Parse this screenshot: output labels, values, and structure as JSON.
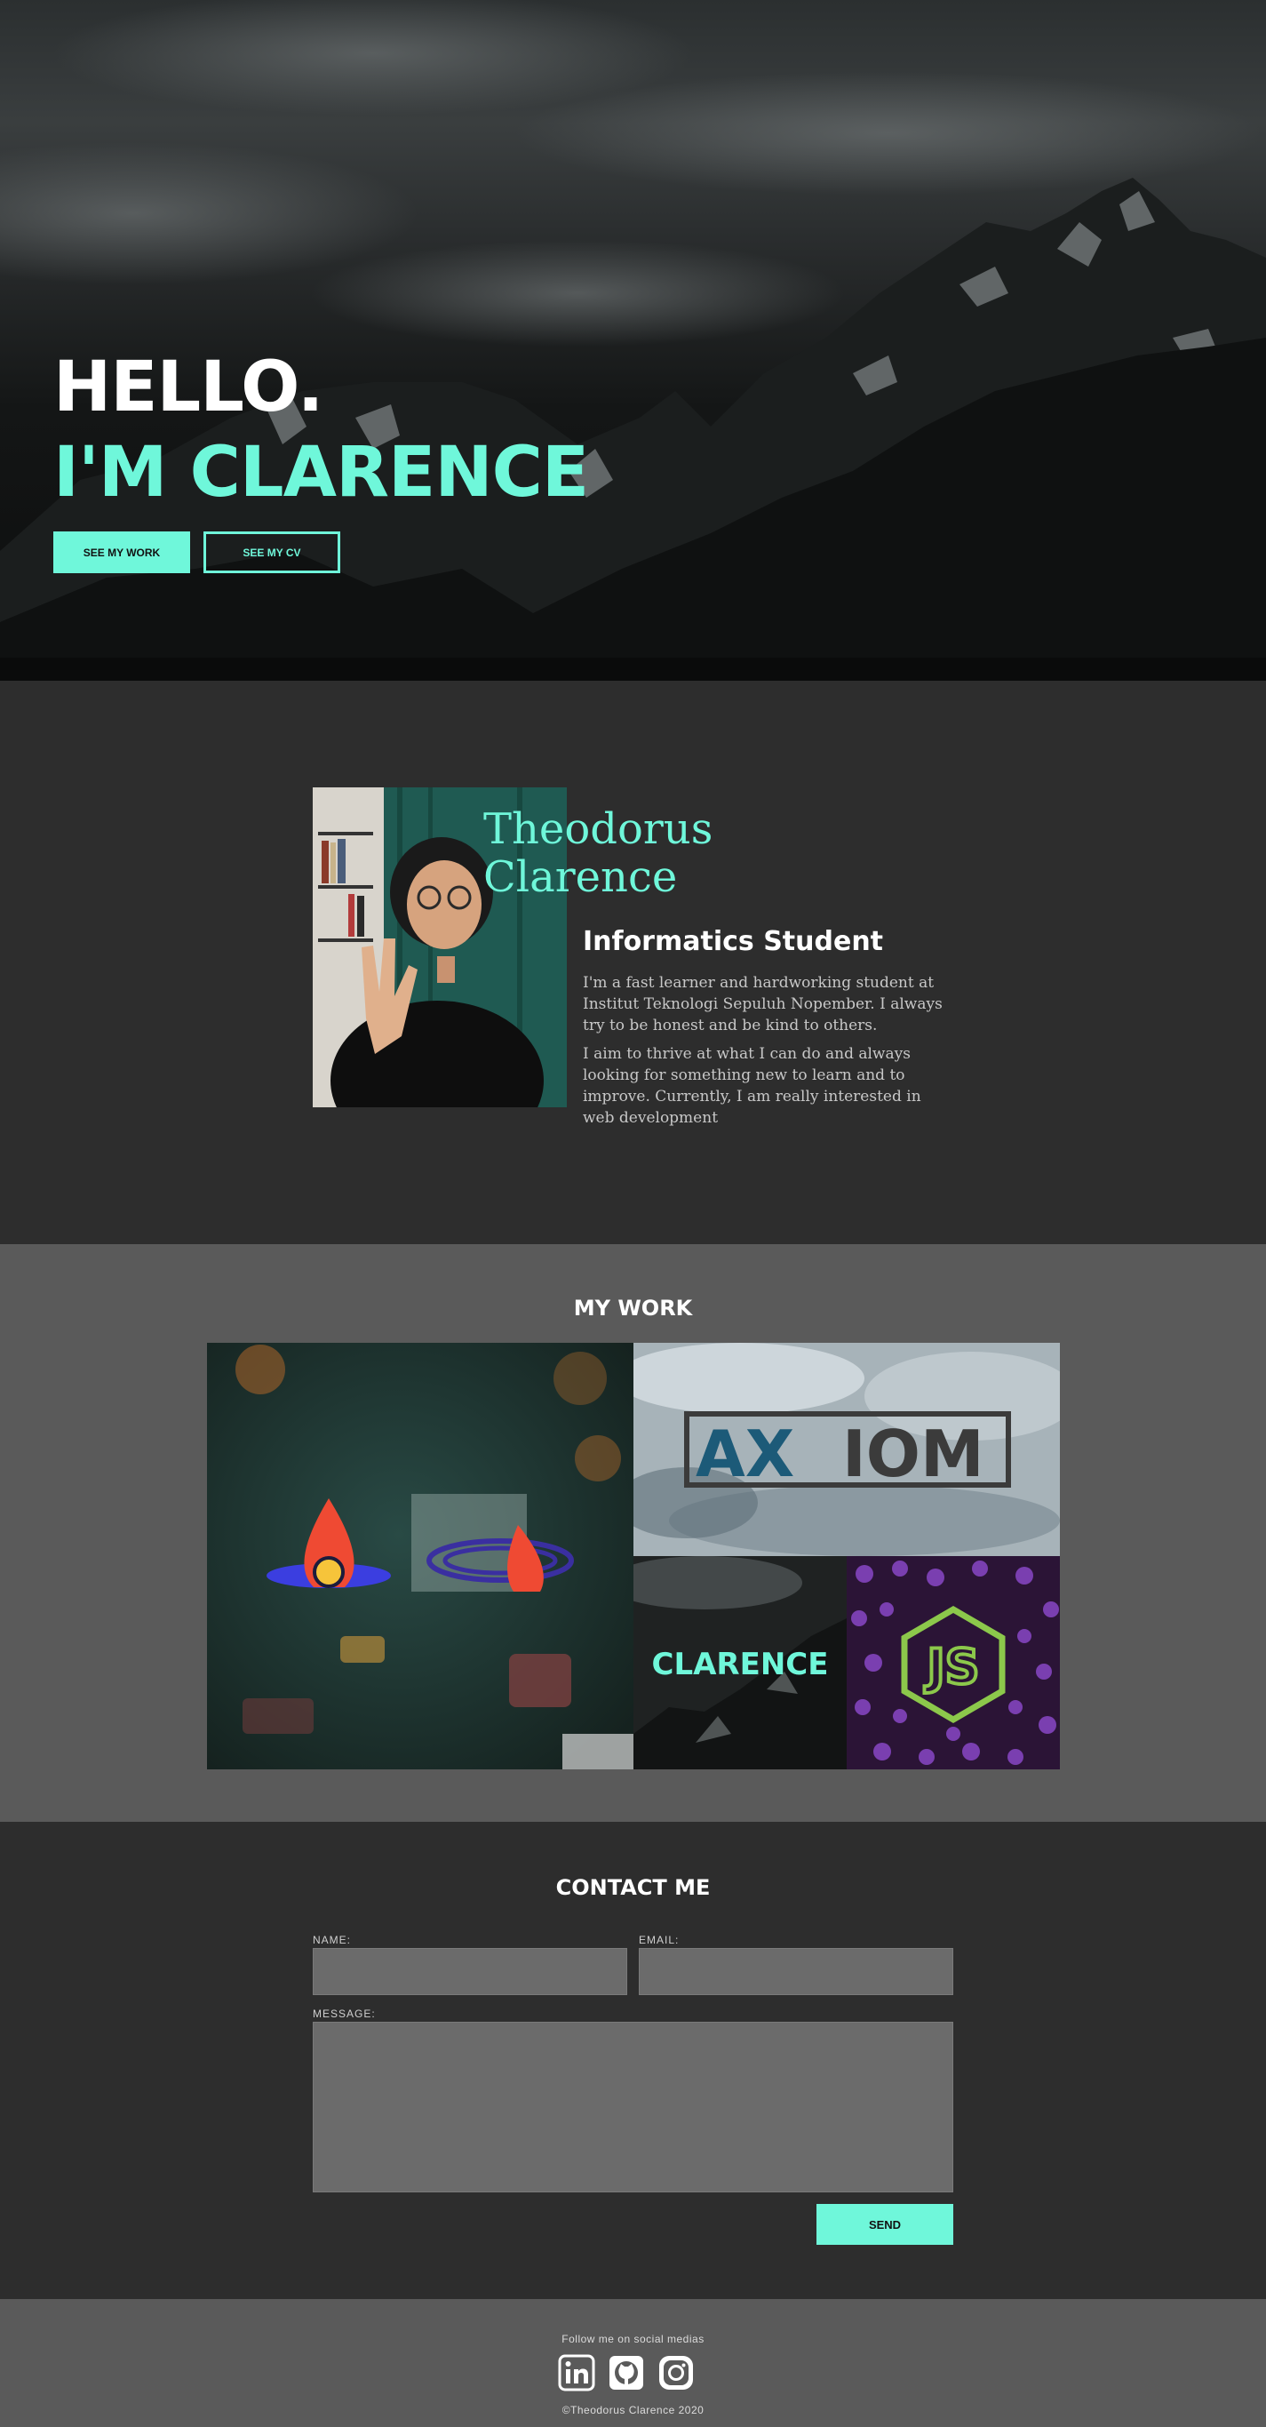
{
  "hero": {
    "line1": "HELLO.",
    "line2": "I'M CLARENCE",
    "btn_work": "SEE MY WORK",
    "btn_cv": "SEE MY CV"
  },
  "about": {
    "name_line1": "Theodorus",
    "name_line2": "Clarence",
    "role": "Informatics Student",
    "bio1": "I'm a fast learner and hardworking student at Institut Teknologi Sepuluh Nopember. I always try to be honest and be kind to others.",
    "bio2": "I aim to thrive at what I can do and always looking for something new to learn and to improve. Currently, I am really interested in web development"
  },
  "work": {
    "title": "MY WORK",
    "tiles": [
      {
        "name": "rocket-planet-project"
      },
      {
        "name": "axiom-project",
        "label": "AXIOM"
      },
      {
        "name": "clarence-portfolio-project",
        "label": "CLARENCE"
      },
      {
        "name": "nodejs-project",
        "label": "JS"
      }
    ]
  },
  "contact": {
    "title": "CONTACT ME",
    "name_label": "NAME:",
    "email_label": "EMAIL:",
    "message_label": "MESSAGE:",
    "send_label": "SEND"
  },
  "footer": {
    "follow": "Follow me on social medias",
    "copyright": "©Theodorus Clarence 2020",
    "icons": [
      "linkedin-icon",
      "github-icon",
      "instagram-icon"
    ]
  },
  "colors": {
    "accent": "#6ff7da",
    "dark": "#2d2d2d",
    "mid": "#5a5a5a",
    "field": "#6b6b6b"
  }
}
